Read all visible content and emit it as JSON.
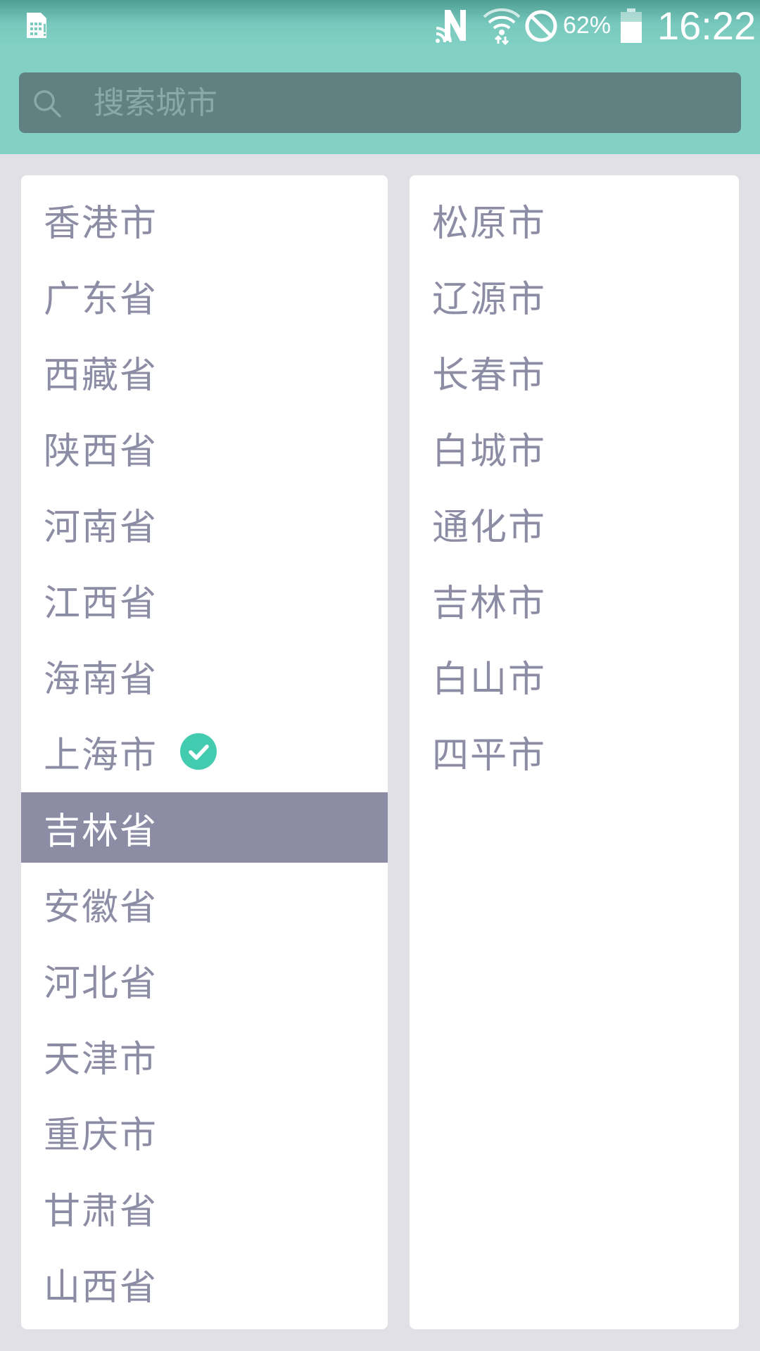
{
  "statusbar": {
    "battery_percent": "62%",
    "time": "16:22",
    "icons": [
      "sim-card-alert-icon",
      "nfc-icon",
      "wifi-icon",
      "do-not-disturb-icon",
      "battery-icon"
    ]
  },
  "search": {
    "placeholder": "搜索城市",
    "icon": "search-icon"
  },
  "provinces": [
    {
      "label": "香港市"
    },
    {
      "label": "广东省"
    },
    {
      "label": "西藏省"
    },
    {
      "label": "陕西省"
    },
    {
      "label": "河南省"
    },
    {
      "label": "江西省"
    },
    {
      "label": "海南省"
    },
    {
      "label": "上海市",
      "checked": true
    },
    {
      "label": "吉林省",
      "selected": true
    },
    {
      "label": "安徽省"
    },
    {
      "label": "河北省"
    },
    {
      "label": "天津市"
    },
    {
      "label": "重庆市"
    },
    {
      "label": "甘肃省"
    },
    {
      "label": "山西省"
    }
  ],
  "cities": [
    {
      "label": "松原市"
    },
    {
      "label": "辽源市"
    },
    {
      "label": "长春市"
    },
    {
      "label": "白城市"
    },
    {
      "label": "通化市"
    },
    {
      "label": "吉林市"
    },
    {
      "label": "白山市"
    },
    {
      "label": "四平市"
    }
  ],
  "colors": {
    "header": "#83d1c5",
    "search_bg": "#5f8281",
    "item_text": "#8d8ca5",
    "selected_bg": "#8d8ca5",
    "check": "#43cbb0",
    "page_bg": "#e1e0e7"
  }
}
